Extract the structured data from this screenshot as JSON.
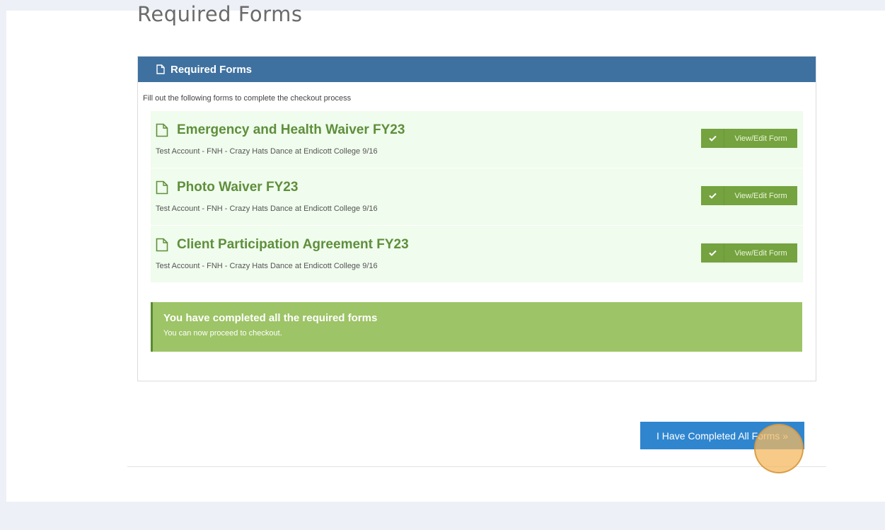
{
  "page": {
    "title": "Required Forms"
  },
  "panel": {
    "header": "Required Forms",
    "header_icon": "document-icon",
    "intro": "Fill out the following forms to complete the checkout process",
    "forms": [
      {
        "title": "Emergency and Health Waiver FY23",
        "subtitle": "Test Account - FNH - Crazy Hats Dance at Endicott College 9/16",
        "button_label": "View/Edit Form",
        "icon": "document-icon",
        "button_icon": "checkmark-icon"
      },
      {
        "title": "Photo Waiver FY23",
        "subtitle": "Test Account - FNH - Crazy Hats Dance at Endicott College 9/16",
        "button_label": "View/Edit Form",
        "icon": "document-icon",
        "button_icon": "checkmark-icon"
      },
      {
        "title": "Client Participation Agreement FY23",
        "subtitle": "Test Account - FNH - Crazy Hats Dance at Endicott College 9/16",
        "button_label": "View/Edit Form",
        "icon": "document-icon",
        "button_icon": "checkmark-icon"
      }
    ],
    "alert": {
      "title": "You have completed all the required forms",
      "message": "You can now proceed to checkout."
    }
  },
  "actions": {
    "complete_label": "I Have Completed All Forms »"
  },
  "colors": {
    "header": "#3e71a0",
    "form_title": "#5e8f3c",
    "button": "#74a33f",
    "alert": "#9dc466",
    "primary": "#2f86cf"
  }
}
